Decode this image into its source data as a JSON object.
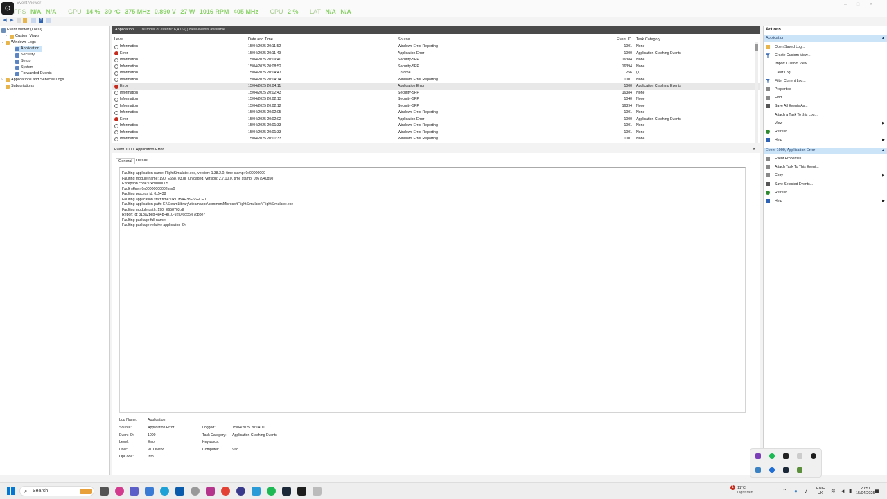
{
  "overlay": {
    "app_logo": "⊙",
    "ghost_title": "Event Viewer",
    "fps_label": "FPS",
    "fps_value": "N/A",
    "fps_value2": "N/A",
    "gpu_label": "GPU",
    "gpu_load": "14 %",
    "gpu_temp": "30 °C",
    "gpu_clock": "375 MHz",
    "gpu_volt": "0.890 V",
    "gpu_power": "27 W",
    "gpu_fan": "1016 RPM",
    "gpu_mem": "405 MHz",
    "cpu_label": "CPU",
    "cpu_load": "2 %",
    "lat_label": "LAT",
    "lat_value": "N/A",
    "lat_value2": "N/A"
  },
  "tree": {
    "root": "Event Viewer (Local)",
    "custom_views": "Custom Views",
    "windows_logs": "Windows Logs",
    "application": "Application",
    "security": "Security",
    "setup": "Setup",
    "system": "System",
    "forwarded": "Forwarded Events",
    "apps_services": "Applications and Services Logs",
    "subscriptions": "Subscriptions"
  },
  "events": {
    "title": "Application",
    "count": "Number of events: 6,416 (!) New events available",
    "columns": {
      "level": "Level",
      "date": "Date and Time",
      "source": "Source",
      "id": "Event ID",
      "category": "Task Category"
    },
    "rows": [
      {
        "level": "Information",
        "date": "15/04/2025 20:11:52",
        "source": "Windows Error Reporting",
        "id": "1001",
        "category": "None"
      },
      {
        "level": "Error",
        "date": "15/04/2025 20:11:49",
        "source": "Application Error",
        "id": "1000",
        "category": "Application Crashing Events"
      },
      {
        "level": "Information",
        "date": "15/04/2025 20:09:40",
        "source": "Security-SPP",
        "id": "16384",
        "category": "None"
      },
      {
        "level": "Information",
        "date": "15/04/2025 20:08:52",
        "source": "Security-SPP",
        "id": "16394",
        "category": "None"
      },
      {
        "level": "Information",
        "date": "15/04/2025 20:04:47",
        "source": "Chrome",
        "id": "256",
        "category": "(1)"
      },
      {
        "level": "Information",
        "date": "15/04/2025 20:04:14",
        "source": "Windows Error Reporting",
        "id": "1001",
        "category": "None"
      },
      {
        "level": "Error",
        "date": "15/04/2025 20:04:11",
        "source": "Application Error",
        "id": "1000",
        "category": "Application Crashing Events"
      },
      {
        "level": "Information",
        "date": "15/04/2025 20:02:43",
        "source": "Security-SPP",
        "id": "16384",
        "category": "None"
      },
      {
        "level": "Information",
        "date": "15/04/2025 20:02:13",
        "source": "Security-SPP",
        "id": "1040",
        "category": "None"
      },
      {
        "level": "Information",
        "date": "15/04/2025 20:02:12",
        "source": "Security-SPP",
        "id": "16394",
        "category": "None"
      },
      {
        "level": "Information",
        "date": "15/04/2025 20:02:05",
        "source": "Windows Error Reporting",
        "id": "1001",
        "category": "None"
      },
      {
        "level": "Error",
        "date": "15/04/2025 20:02:02",
        "source": "Application Error",
        "id": "1000",
        "category": "Application Crashing Events"
      },
      {
        "level": "Information",
        "date": "15/04/2025 20:01:33",
        "source": "Windows Error Reporting",
        "id": "1001",
        "category": "None"
      },
      {
        "level": "Information",
        "date": "15/04/2025 20:01:33",
        "source": "Windows Error Reporting",
        "id": "1001",
        "category": "None"
      },
      {
        "level": "Information",
        "date": "15/04/2025 20:01:33",
        "source": "Windows Error Reporting",
        "id": "1001",
        "category": "None"
      }
    ]
  },
  "detail": {
    "title": "Event 1000, Application Error",
    "close": "✕",
    "tab_general": "General",
    "tab_details": "Details",
    "lines": [
      "Faulting application name: FlightSimulator.exe, version: 1.38.2.0, time stamp: 0x00000000",
      "Faulting module name: 190_E658703.dll_unloaded, version: 2.7.10.0, time stamp: 0x67940d50",
      "Exception code: 0xc0000005",
      "Fault offset: 0x00000000002ccc0",
      "Faulting process id: 0x5438",
      "Faulting application start time: 0x1DBAE38E66ECF0",
      "Faulting application path: E:\\SteamLibrary\\steamapps\\common\\MicrosoftFlightSimulator\\FlightSimulator.exe",
      "Faulting module path: 190_E658703.dll",
      "Report Id: 318a2beb-484b-4b10-92f0-6d55fe7cbbe7",
      "Faulting package full name:",
      "Faulting package-relative application ID:"
    ],
    "fields": {
      "log_name_l": "Log Name:",
      "log_name": "Application",
      "source_l": "Source:",
      "source": "Application Error",
      "logged_l": "Logged:",
      "logged": "15/04/2025 20:04:11",
      "event_id_l": "Event ID:",
      "event_id": "1000",
      "task_cat_l": "Task Category:",
      "task_cat": "Application Crashing Events",
      "level_l": "Level:",
      "level": "Error",
      "keywords_l": "Keywords:",
      "keywords": "",
      "user_l": "User:",
      "user": "VITO\\vitoc",
      "computer_l": "Computer:",
      "computer": "Vito",
      "opcode_l": "OpCode:",
      "opcode": "Info"
    }
  },
  "actions": {
    "title": "Actions",
    "section1": "Application",
    "items1": [
      {
        "label": "Open Saved Log...",
        "icon": "folder"
      },
      {
        "label": "Create Custom View...",
        "icon": "filter"
      },
      {
        "label": "Import Custom View...",
        "icon": "blank"
      },
      {
        "label": "Clear Log...",
        "icon": "blank"
      },
      {
        "label": "Filter Current Log...",
        "icon": "filter"
      },
      {
        "label": "Properties",
        "icon": "prop"
      },
      {
        "label": "Find...",
        "icon": "prop"
      },
      {
        "label": "Save All Events As...",
        "icon": "save"
      },
      {
        "label": "Attach a Task To this Log...",
        "icon": "blank"
      },
      {
        "label": "View",
        "icon": "blank",
        "sub": "▶"
      },
      {
        "label": "Refresh",
        "icon": "refresh"
      },
      {
        "label": "Help",
        "icon": "help",
        "sub": "▶"
      }
    ],
    "section2": "Event 1000, Application Error",
    "items2": [
      {
        "label": "Event Properties",
        "icon": "prop"
      },
      {
        "label": "Attach Task To This Event...",
        "icon": "prop"
      },
      {
        "label": "Copy",
        "icon": "prop",
        "sub": "▶"
      },
      {
        "label": "Save Selected Events...",
        "icon": "save"
      },
      {
        "label": "Refresh",
        "icon": "refresh"
      },
      {
        "label": "Help",
        "icon": "help",
        "sub": "▶"
      }
    ]
  },
  "taskbar": {
    "search": "Search",
    "weather_temp": "11°C",
    "weather_desc": "Light rain",
    "weather_badge": "1",
    "lang1": "ENG",
    "lang2": "UK",
    "time": "20:51",
    "date": "15/04/2025"
  },
  "colors": {
    "accent": "#0078d4",
    "osd_green": "#8cd26a",
    "error_red": "#c42b1c",
    "header_dark": "#4a4a4a",
    "selection": "#cce4f7"
  }
}
